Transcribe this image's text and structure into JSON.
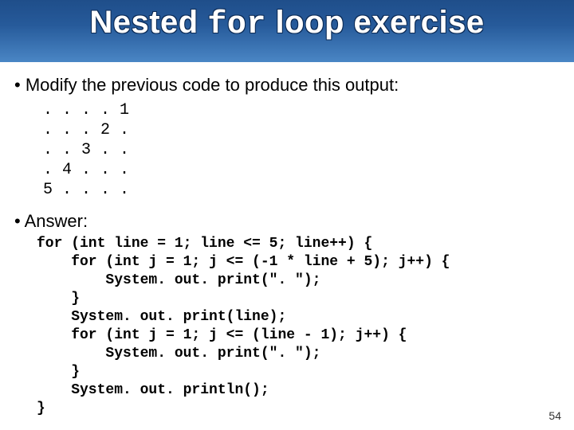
{
  "title": {
    "pre": "Nested ",
    "mono": "for",
    "post": " loop exercise"
  },
  "bullet1": "Modify the previous code to produce this output:",
  "output": ". . . . 1\n. . . 2 .\n. . 3 . .\n. 4 . . .\n5 . . . .",
  "answer_label": "Answer:",
  "code": "for (int line = 1; line <= 5; line++) {\n    for (int j = 1; j <= (-1 * line + 5); j++) {\n        System. out. print(\". \");\n    }\n    System. out. print(line);\n    for (int j = 1; j <= (line - 1); j++) {\n        System. out. print(\". \");\n    }\n    System. out. println();\n}",
  "page_number": "54"
}
